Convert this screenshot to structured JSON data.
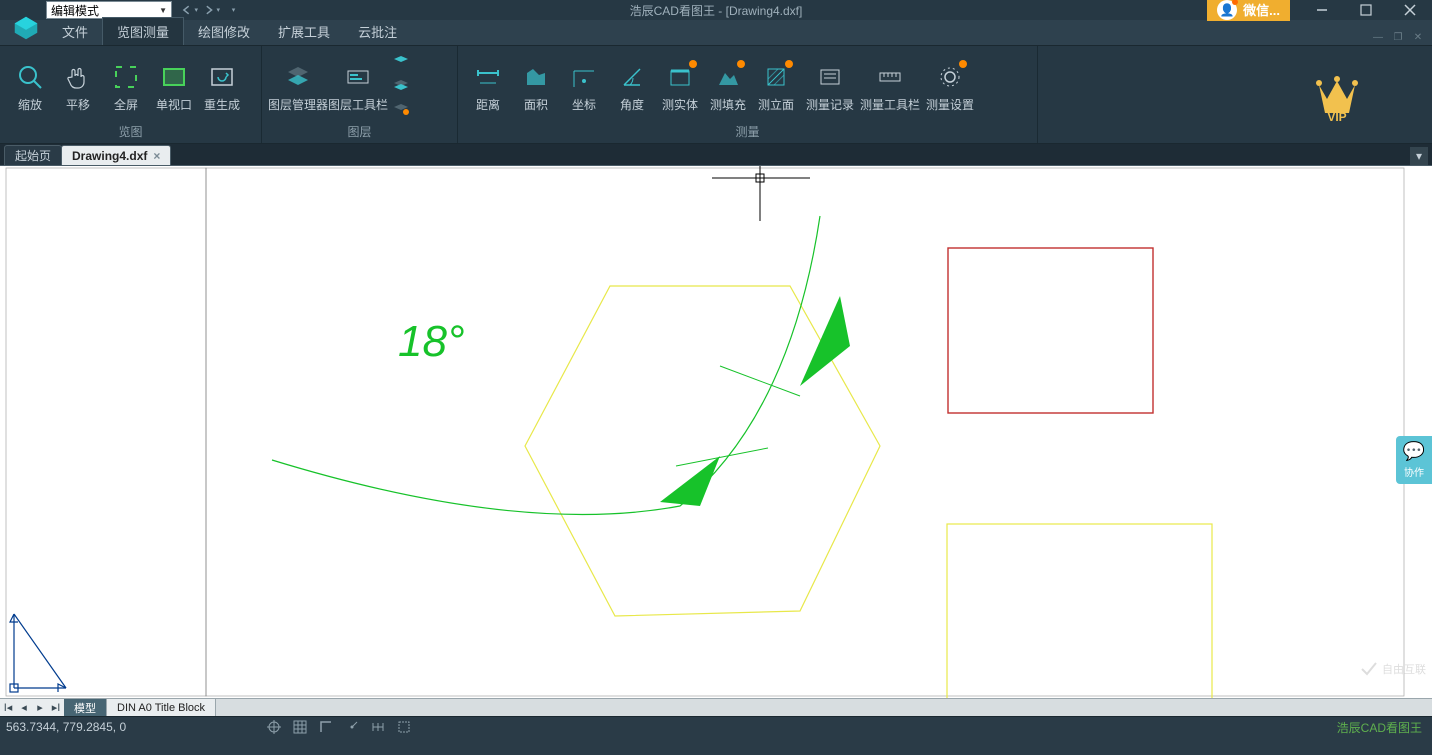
{
  "title": "浩辰CAD看图王 - [Drawing4.dxf]",
  "mode": "编辑模式",
  "wechat": "微信...",
  "menu": {
    "file": "文件",
    "view_measure": "览图测量",
    "edit_draw": "绘图修改",
    "ext_tools": "扩展工具",
    "cloud_annot": "云批注"
  },
  "ribbon": {
    "groups": {
      "view": {
        "label": "览图",
        "zoom": "缩放",
        "pan": "平移",
        "fullscreen": "全屏",
        "single_view": "单视口",
        "regen": "重生成"
      },
      "layer": {
        "label": "图层",
        "layer_mgr": "图层管理器",
        "layer_toolbar": "图层工具栏"
      },
      "measure": {
        "label": "测量",
        "distance": "距离",
        "area": "面积",
        "coord": "坐标",
        "angle": "角度",
        "solid": "测实体",
        "fill": "测填充",
        "section": "测立面",
        "record": "测量记录",
        "toolbar": "测量工具栏",
        "settings": "测量设置"
      }
    },
    "vip": "VIP"
  },
  "doctabs": {
    "start": "起始页",
    "drawing": "Drawing4.dxf"
  },
  "canvas_annotation": "18°",
  "collab": "协作",
  "layout": {
    "model": "模型",
    "sheet1": "DIN A0 Title Block"
  },
  "status": {
    "coords": "563.7344, 779.2845, 0",
    "brand": "浩辰CAD看图王"
  },
  "watermark": "自由互联"
}
